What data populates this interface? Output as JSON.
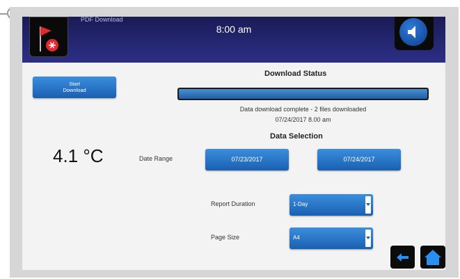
{
  "header": {
    "small_text": "PDF Download",
    "time": "8:00 am",
    "flag_icon": "flag-icon",
    "sound_icon": "speaker-icon"
  },
  "actions": {
    "start_download_line1": "Start",
    "start_download_line2": "Download"
  },
  "download_status": {
    "title": "Download Status",
    "progress": 1.0,
    "message": "Data download complete - 2 files downloaded",
    "timestamp": "07/24/2017 8.00 am"
  },
  "temperature": "4.1 °C",
  "data_selection": {
    "title": "Data Selection",
    "date_range_label": "Date Range",
    "start_date": "07/23/2017",
    "end_date": "07/24/2017",
    "report_duration_label": "Report Duration",
    "report_duration_value": "1-Day",
    "page_size_label": "Page Size",
    "page_size_value": "A4"
  },
  "nav": {
    "back_icon": "back-arrow-icon",
    "home_icon": "home-icon"
  },
  "colors": {
    "header": "#22257a",
    "button": "#2a76c8",
    "panel": "#f3f3f3",
    "frame": "#d6d6d6"
  }
}
